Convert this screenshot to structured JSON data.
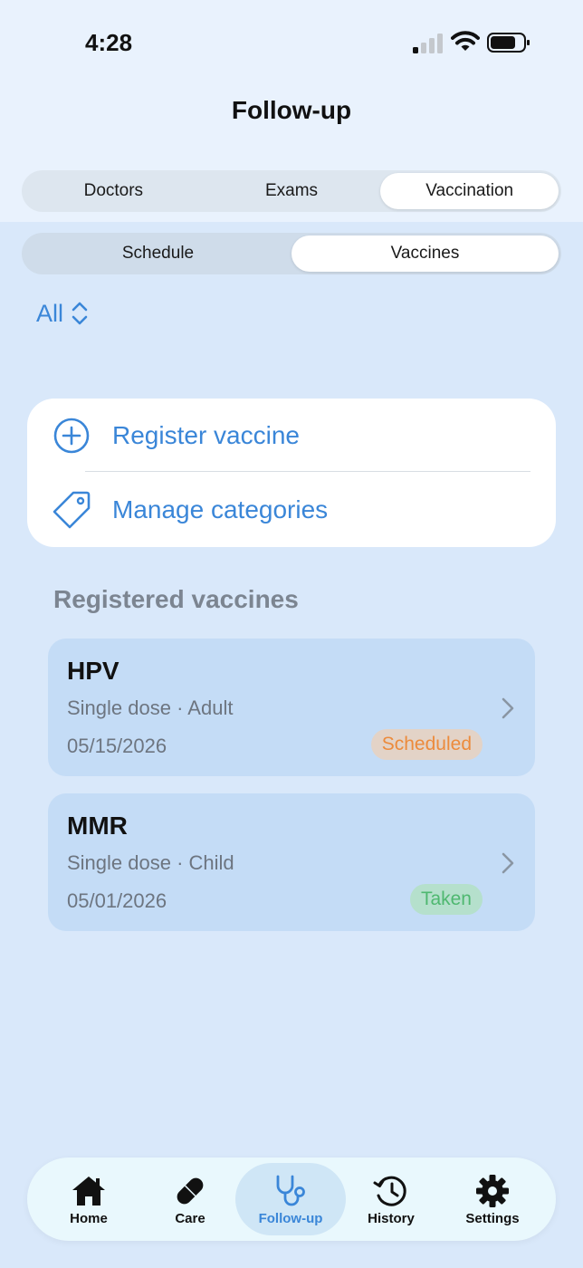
{
  "status_bar": {
    "time": "4:28"
  },
  "header": {
    "title": "Follow-up"
  },
  "main_tabs": [
    {
      "label": "Doctors",
      "active": false
    },
    {
      "label": "Exams",
      "active": false
    },
    {
      "label": "Vaccination",
      "active": true
    }
  ],
  "sub_tabs": [
    {
      "label": "Schedule",
      "active": false
    },
    {
      "label": "Vaccines",
      "active": true
    }
  ],
  "filter": {
    "label": "All"
  },
  "actions": [
    {
      "label": "Register vaccine",
      "icon": "plus-circle-icon"
    },
    {
      "label": "Manage categories",
      "icon": "tag-icon"
    }
  ],
  "section": {
    "title": "Registered vaccines"
  },
  "vaccines": [
    {
      "name": "HPV",
      "description": "Single dose · Adult",
      "date": "05/15/2026",
      "status": "Scheduled"
    },
    {
      "name": "MMR",
      "description": "Single dose · Child",
      "date": "05/01/2026",
      "status": "Taken"
    }
  ],
  "tab_bar": [
    {
      "label": "Home",
      "icon": "house-icon"
    },
    {
      "label": "Care",
      "icon": "pill-icon"
    },
    {
      "label": "Follow-up",
      "icon": "stethoscope-icon",
      "active": true
    },
    {
      "label": "History",
      "icon": "history-clock-icon"
    },
    {
      "label": "Settings",
      "icon": "gear-icon"
    }
  ],
  "colors": {
    "accent": "#3a86d8",
    "background": "#d9e8fa",
    "card": "#c4dcf6",
    "scheduled": "#ec8b3c",
    "taken": "#4fb870"
  }
}
